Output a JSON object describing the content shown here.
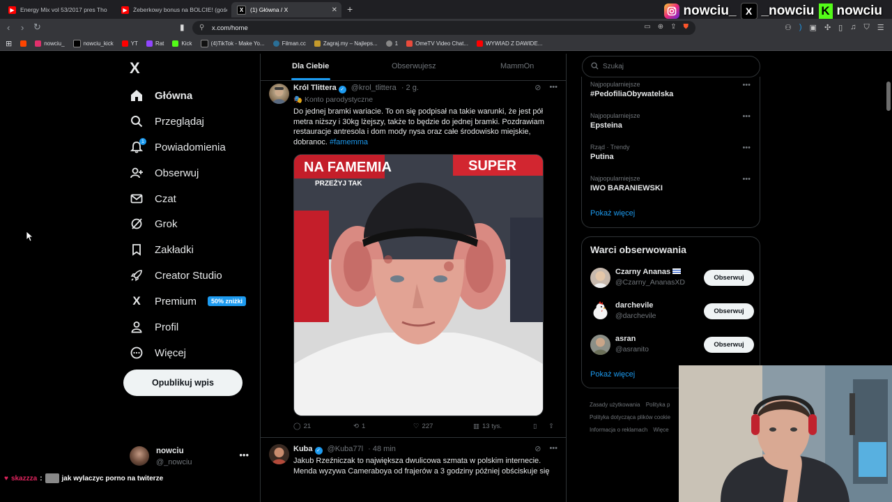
{
  "browser": {
    "tabs": [
      {
        "label": "Energy Mix vol 53/2017 pres Tho",
        "icon": "youtube-icon",
        "color": "#ff0000",
        "active": false
      },
      {
        "label": "Żeberkowy bonus na BOLCIE! (gościo",
        "icon": "youtube-icon",
        "color": "#ff0000",
        "active": false
      },
      {
        "label": "(1) Główna / X",
        "icon": "x-icon",
        "color": "#000000",
        "active": true
      }
    ],
    "new_tab": "+",
    "url": "x.com/home",
    "bookmarks": [
      {
        "label": "",
        "color": "#ff4500"
      },
      {
        "label": "nowciu_",
        "color": "#e1306c"
      },
      {
        "label": "nowciu_kick",
        "color": "#000000"
      },
      {
        "label": "YT",
        "color": "#ff0000"
      },
      {
        "label": "Rat",
        "color": "#9146ff"
      },
      {
        "label": "Kick",
        "color": "#53fc18"
      },
      {
        "label": "(4)TikTok - Make Yo...",
        "color": "#111111"
      },
      {
        "label": "Filman.cc",
        "color": "#2a6f97"
      },
      {
        "label": "Zagraj.my – Najleps...",
        "color": "#c49a2c"
      },
      {
        "label": "1",
        "color": "#888888"
      },
      {
        "label": "OmeTV Video Chat...",
        "color": "#e94b3c"
      },
      {
        "label": "WYWIAD Z DAWIDE...",
        "color": "#ff0000"
      }
    ]
  },
  "overlay": {
    "instagram_handle": "nowciu_",
    "x_handle": "_nowciu",
    "kick_handle": "nowciu"
  },
  "sidebar": {
    "logo": "X",
    "items": [
      {
        "label": "Główna",
        "icon": "home-icon"
      },
      {
        "label": "Przeglądaj",
        "icon": "search-icon"
      },
      {
        "label": "Powiadomienia",
        "icon": "bell-icon",
        "badge": "1"
      },
      {
        "label": "Obserwuj",
        "icon": "follow-icon"
      },
      {
        "label": "Czat",
        "icon": "mail-icon"
      },
      {
        "label": "Grok",
        "icon": "grok-icon"
      },
      {
        "label": "Zakładki",
        "icon": "bookmark-icon"
      },
      {
        "label": "Creator Studio",
        "icon": "rocket-icon"
      },
      {
        "label": "Premium",
        "icon": "x-premium-icon",
        "promo": "50% zniżki"
      },
      {
        "label": "Profil",
        "icon": "profile-icon"
      },
      {
        "label": "Więcej",
        "icon": "more-icon"
      }
    ],
    "post_button": "Opublikuj wpis",
    "account": {
      "name": "nowciu",
      "handle": "@_nowciu"
    }
  },
  "feed": {
    "tabs": [
      "Dla Ciebie",
      "Obserwujesz",
      "MammOn"
    ],
    "tweets": [
      {
        "name": "Król Tlittera",
        "handle": "@krol_tlittera",
        "time": "· 2 g.",
        "parody": "Konto parodystyczne",
        "text": "Do jednej bramki wariacie. To on się podpisał na takie warunki, że jest pół metra niższy i 30kg lżejszy, także to będzie do jednej bramki. Pozdrawiam restauracje antresola i dom mody nysa oraz całe środowisko miejskie, dobranoc.",
        "hashtag": "#famemma",
        "replies": "21",
        "reposts": "1",
        "likes": "227",
        "views": "13 tys."
      },
      {
        "name": "Kuba",
        "handle": "@Kuba77l",
        "time": "· 48 min",
        "text": "Jakub Rzeźniczak to największa dwulicowa szmata w polskim internecie. Menda wyzywa Cameraboya od frajerów a 3 godziny później obściskuje się"
      }
    ],
    "media_banner": {
      "left": "NA FAMEMIA",
      "sub": "PRZEŻYJ TAK",
      "right": "SUPER"
    }
  },
  "right": {
    "search_placeholder": "Szukaj",
    "trends": [
      {
        "context": "Najpopularniejsze",
        "title": "#PedofiliaObywatelska"
      },
      {
        "context": "Najpopularniejsze",
        "title": "Epsteina"
      },
      {
        "context": "Rząd · Trendy",
        "title": "Putina"
      },
      {
        "context": "Najpopularniejsze",
        "title": "IWO BARANIEWSKI"
      }
    ],
    "trends_more": "Pokaż więcej",
    "who_title": "Warci obserwowania",
    "who": [
      {
        "name": "Czarny Ananas",
        "handle": "@Czarny_AnanasXD",
        "icon": "flag-icon"
      },
      {
        "name": "darchevile",
        "handle": "@darchevile",
        "icon": "chicken-icon"
      },
      {
        "name": "asran",
        "handle": "@asranito",
        "icon": "avatar-icon"
      }
    ],
    "follow_label": "Obserwuj",
    "who_more": "Pokaż więcej",
    "footer": [
      "Zasady użytkowania",
      "Polityka p",
      "Polityka dotycząca plików cookie",
      "Informacja o reklamach",
      "Więce"
    ]
  },
  "chat": {
    "user": "skazzza",
    "sep": ":",
    "message": "jak wylaczyc porno na twiterze"
  },
  "colors": {
    "accent": "#1d9bf0",
    "bg": "#000000",
    "border": "#2f3336",
    "muted": "#71767b"
  }
}
